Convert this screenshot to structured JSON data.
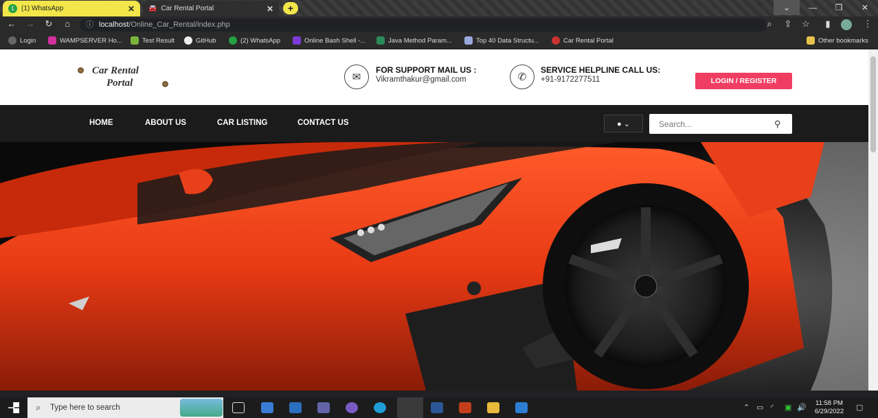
{
  "browser": {
    "tabs": [
      {
        "label": "(1) WhatsApp",
        "badge": "1"
      },
      {
        "label": "Car Rental Portal"
      }
    ],
    "new_tab": "+",
    "url_host": "localhost",
    "url_path": "/Online_Car_Rental/index.php",
    "bookmarks": [
      {
        "label": "Login"
      },
      {
        "label": "WAMPSERVER Ho..."
      },
      {
        "label": "Test Result"
      },
      {
        "label": "GitHub"
      },
      {
        "label": "(2) WhatsApp"
      },
      {
        "label": "Online Bash Shell -..."
      },
      {
        "label": "Java Method Param..."
      },
      {
        "label": "Top 40 Data Structu..."
      },
      {
        "label": "Car Rental Portal"
      }
    ],
    "other_bookmarks": "Other bookmarks"
  },
  "site": {
    "logo_line1": "Car Rental",
    "logo_line2": "Portal",
    "support_title": "FOR SUPPORT MAIL US :",
    "support_email": "Vikramthakur@gmail.com",
    "helpline_title": "SERVICE HELPLINE CALL US:",
    "helpline_phone": "+91-9172277511",
    "login_label": "LOGIN / REGISTER",
    "nav": [
      "HOME",
      "ABOUT US",
      "CAR LISTING",
      "CONTACT US"
    ],
    "search_placeholder": "Search..."
  },
  "taskbar": {
    "search_placeholder": "Type here to search",
    "time": "11:58 PM",
    "date": "6/29/2022"
  },
  "colors": {
    "accent": "#f03e63",
    "navbar": "#1b1b1b",
    "tab_active": "#f2e64a"
  }
}
